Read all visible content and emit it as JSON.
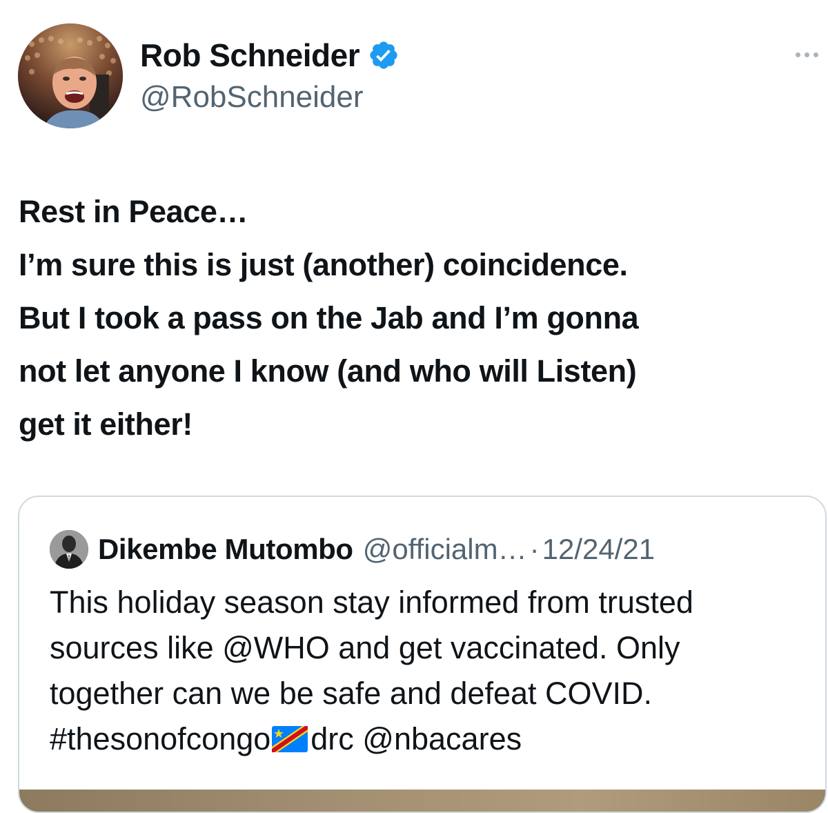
{
  "author": {
    "display_name": "Rob Schneider",
    "handle": "@RobSchneider",
    "verified": true,
    "verified_color": "#1d9bf0"
  },
  "tweet": {
    "lines": [
      "Rest in Peace…",
      "I’m sure this is just (another) coincidence.",
      "But I took a pass on the Jab and I’m gonna",
      "not let anyone I know (and who will Listen)",
      "get it either!"
    ]
  },
  "quoted_tweet": {
    "display_name": "Dikembe Mutombo",
    "handle": "@officialm…",
    "separator": "·",
    "date": "12/24/21",
    "lines": [
      "This holiday season stay informed from trusted",
      "sources like @WHO and get vaccinated. Only",
      "together can we be safe and defeat COVID."
    ],
    "last_line": {
      "hashtag": "#thesonofcongo",
      "flag_icon": "flag-drc-icon",
      "after_flag": "drc @nbacares"
    }
  },
  "icons": {
    "more": "more-options-icon",
    "verified": "verified-badge-icon"
  },
  "colors": {
    "text_primary": "#0f1419",
    "text_secondary": "#536471",
    "border": "#cfd9de"
  }
}
